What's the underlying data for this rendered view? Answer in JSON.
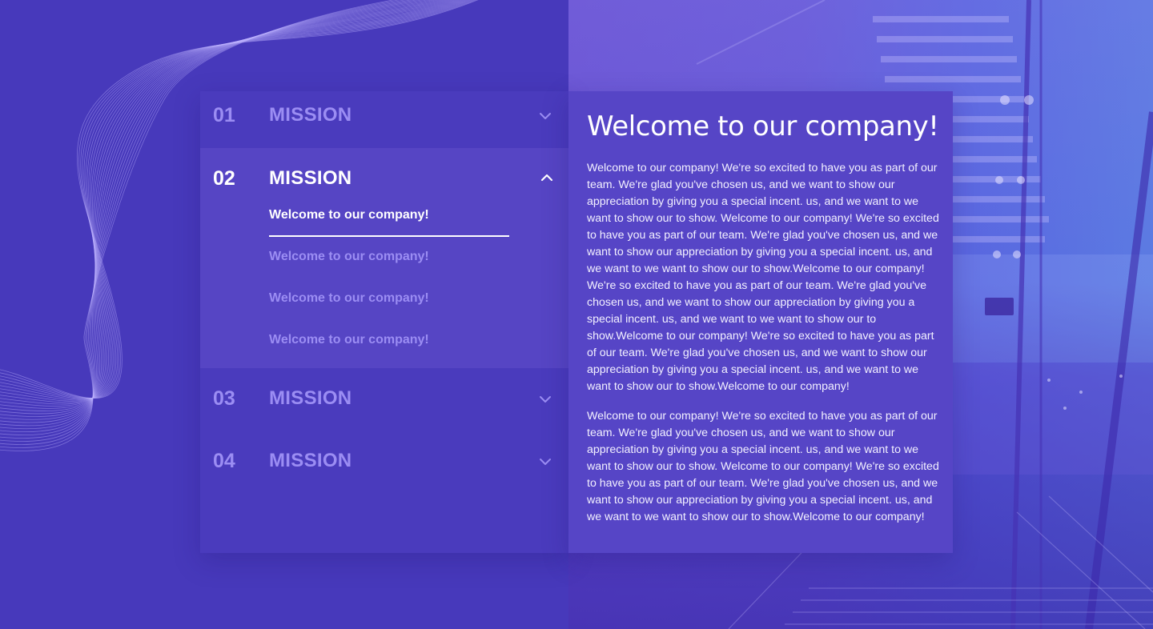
{
  "accordion": {
    "items": [
      {
        "number": "01",
        "title": "MISSION",
        "icon": "chevron-down-icon",
        "expanded": false
      },
      {
        "number": "02",
        "title": "MISSION",
        "icon": "chevron-up-icon",
        "expanded": true,
        "links": [
          {
            "label": "Welcome to our company!",
            "current": true
          },
          {
            "label": "Welcome to our company!",
            "current": false
          },
          {
            "label": "Welcome to our company!",
            "current": false
          },
          {
            "label": "Welcome to our company!",
            "current": false
          }
        ]
      },
      {
        "number": "03",
        "title": "MISSION",
        "icon": "chevron-down-icon",
        "expanded": false
      },
      {
        "number": "04",
        "title": "MISSION",
        "icon": "chevron-down-icon",
        "expanded": false
      }
    ]
  },
  "content": {
    "heading": "Welcome to our company!",
    "paragraphs": [
      "Welcome to our company! We're so excited to have you as part of our team. We're glad you've chosen us, and we want to show our appreciation by giving you a special incent. us, and we want to we want to show our to show. Welcome to our company! We're so excited to have you as part of our team. We're glad you've chosen us, and we want to show our appreciation by giving you a special incent. us, and we want to we want to show our to show.Welcome to our company! We're so excited to have you as part of our team. We're glad you've chosen us, and we want to show our appreciation by giving you a special incent. us, and we want to we want to show our to show.Welcome to our company! We're so excited to have you as part of our team. We're glad you've chosen us, and we want to show our appreciation by giving you a special incent. us, and we want to we want to show our to show.Welcome to our company!",
      "Welcome to our company! We're so excited to have you as part of our team. We're glad you've chosen us, and we want to show our appreciation by giving you a special incent. us, and we want to we want to show our to show. Welcome to our company! We're so excited to have you as part of our team. We're glad you've chosen us, and we want to show our appreciation by giving you a special incent. us, and we want to we want to show our to show.Welcome to our company!"
    ]
  },
  "colors": {
    "background": "#4739bb",
    "panel": "#4a3bbd",
    "panel_active": "#5645c4",
    "muted_text": "#9b8df3",
    "text": "#ffffff"
  }
}
